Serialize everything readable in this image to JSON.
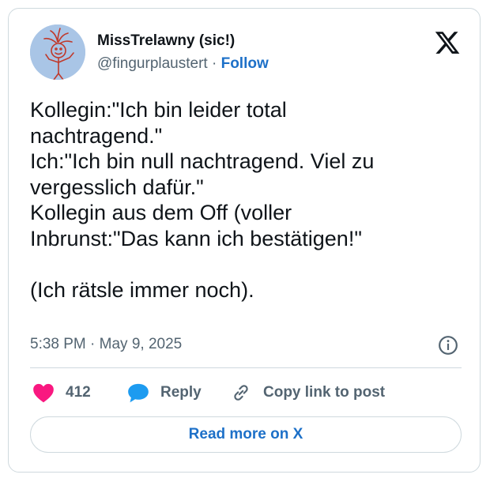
{
  "author": {
    "display_name": "MissTrelawny (sic!)",
    "handle": "@fingurplaustert",
    "separator": "·",
    "follow_label": "Follow"
  },
  "tweet": {
    "text": "Kollegin:\"Ich bin leider total\nnachtragend.\"\nIch:\"Ich bin null nachtragend. Viel zu\nvergesslich dafür.\"\nKollegin aus dem Off (voller\nInbrunst:\"Das kann ich bestätigen!\"\n\n(Ich rätsle immer noch).",
    "timestamp": "5:38 PM · May 9, 2025"
  },
  "actions": {
    "like_count": "412",
    "reply_label": "Reply",
    "copy_link_label": "Copy link to post"
  },
  "footer": {
    "read_more_label": "Read more on X"
  },
  "colors": {
    "accent": "#1d70c8",
    "like": "#f91880",
    "reply": "#1d9bf0",
    "muted": "#536471",
    "border": "#cfd9de"
  },
  "icons": [
    "avatar-drawing",
    "x-logo-icon",
    "info-icon",
    "heart-icon",
    "reply-bubble-icon",
    "link-icon"
  ]
}
